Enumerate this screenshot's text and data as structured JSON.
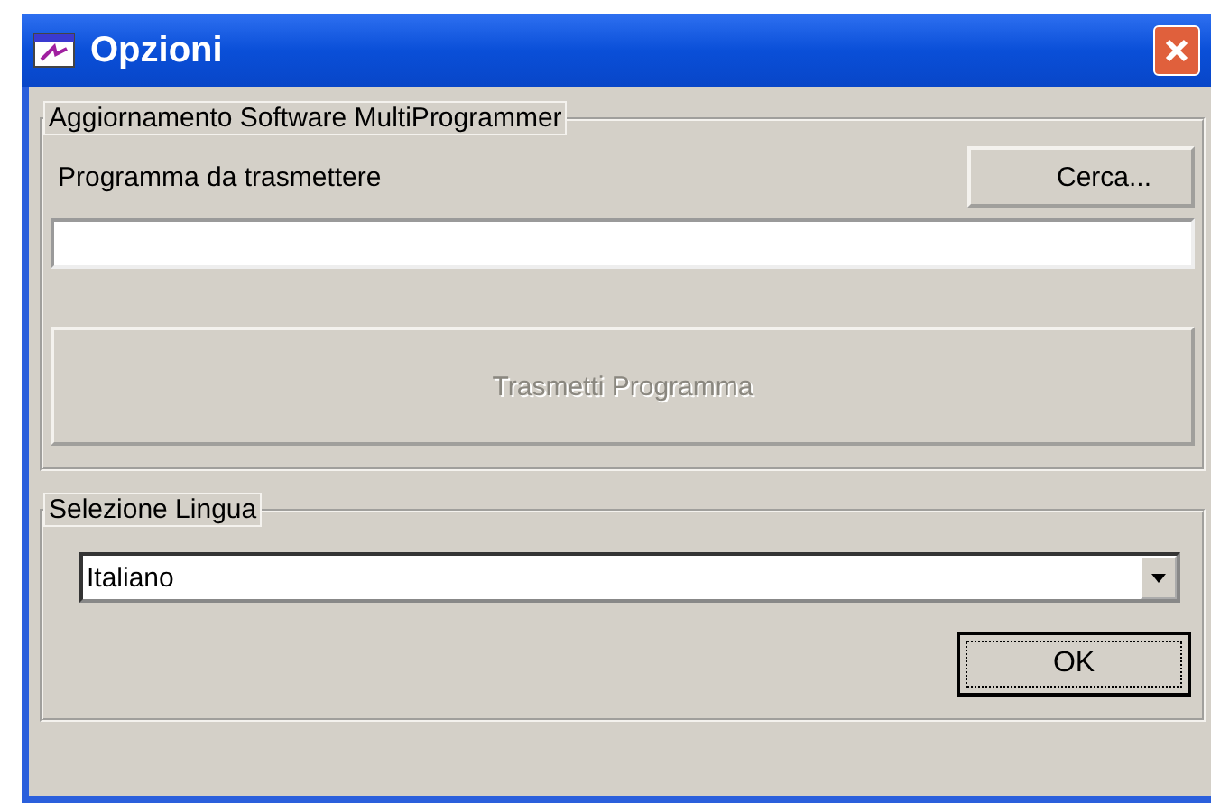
{
  "window": {
    "title": "Opzioni"
  },
  "software_group": {
    "title": "Aggiornamento Software MultiProgrammer",
    "field_label": "Programma da trasmettere",
    "browse_button": "Cerca...",
    "transmit_button": {
      "label": "Trasmetti Programma",
      "disabled": true
    }
  },
  "language_group": {
    "title": "Selezione Lingua",
    "language": "Italiano"
  },
  "buttons": [
    {
      "label": "OK",
      "default": true
    }
  ]
}
